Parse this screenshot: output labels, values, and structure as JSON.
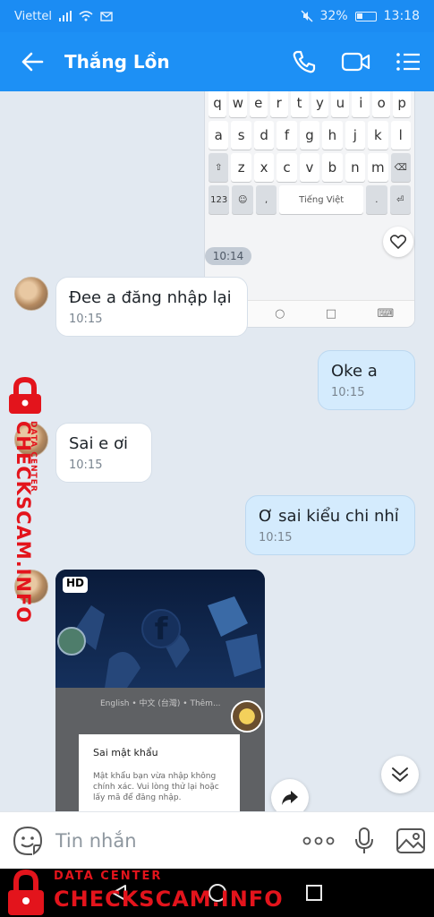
{
  "status": {
    "carrier": "Viettel",
    "battery": "32%",
    "time": "13:18"
  },
  "header": {
    "title": "Thắng Lồn",
    "back_icon": "arrow-left-icon",
    "call_icon": "phone-icon",
    "video_icon": "video-camera-icon",
    "menu_icon": "menu-lines-icon"
  },
  "keyboard": {
    "row1": [
      "q",
      "w",
      "e",
      "r",
      "t",
      "y",
      "u",
      "i",
      "o",
      "p"
    ],
    "row2": [
      "a",
      "s",
      "d",
      "f",
      "g",
      "h",
      "j",
      "k",
      "l"
    ],
    "row3": [
      "z",
      "x",
      "c",
      "v",
      "b",
      "n",
      "m"
    ],
    "numkey": "123",
    "space": "Tiếng Việt"
  },
  "messages": {
    "time_chip": "10:14",
    "m1": {
      "text": "Đee a đăng nhập lại",
      "time": "10:15"
    },
    "m2": {
      "text": "Oke a",
      "time": "10:15"
    },
    "m3": {
      "text": "Sai e ơi",
      "time": "10:15"
    },
    "m4": {
      "text": "Ơ sai kiểu chi nhỉ",
      "time": "10:15"
    }
  },
  "photo": {
    "hd": "HD",
    "lang_line": "English • 中文 (台灣) • Thêm...",
    "dialog_title": "Sai mật khẩu",
    "dialog_body": "Mật khẩu bạn vừa nhập không chính xác. Vui lòng thử lại hoặc lấy mã để đăng nhập."
  },
  "watermark": {
    "sub": "DATA CENTER",
    "main": "CHECKSCAM.INFO"
  },
  "composer": {
    "placeholder": "Tin nhắn"
  },
  "colors": {
    "header": "#1d90f5",
    "out_bubble": "#d4ebfd",
    "watermark": "#e3141c"
  }
}
